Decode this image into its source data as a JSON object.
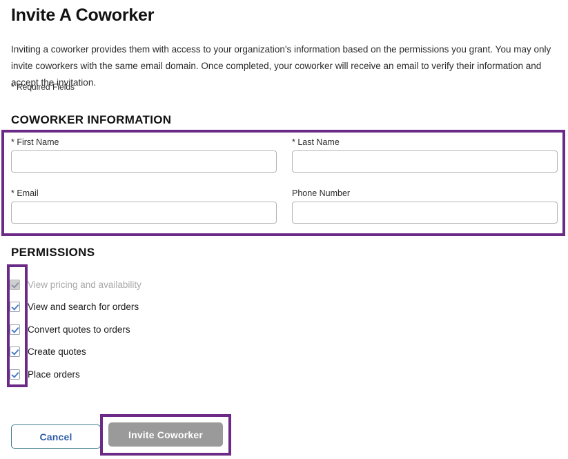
{
  "page": {
    "title": "Invite A Coworker",
    "intro": "Inviting a coworker provides them with access to your organization's information based on the permissions you grant. You may only invite coworkers with the same email domain. Once completed, your coworker will receive an email to verify their information and accept the invitation.",
    "required_note": "* Required Fields"
  },
  "sections": {
    "coworker_information": {
      "header": "COWORKER INFORMATION",
      "fields": [
        {
          "label": "* First Name",
          "value": "",
          "placeholder": ""
        },
        {
          "label": "* Last Name",
          "value": "",
          "placeholder": ""
        },
        {
          "label": "* Email",
          "value": "",
          "placeholder": ""
        },
        {
          "label": "Phone Number",
          "value": "",
          "placeholder": ""
        }
      ]
    },
    "permissions": {
      "header": "PERMISSIONS",
      "items": [
        {
          "label": "View pricing and availability",
          "checked": true,
          "disabled": true
        },
        {
          "label": "View and search for orders",
          "checked": true,
          "disabled": false
        },
        {
          "label": "Convert quotes to orders",
          "checked": true,
          "disabled": false
        },
        {
          "label": "Create quotes",
          "checked": true,
          "disabled": false
        },
        {
          "label": "Place orders",
          "checked": true,
          "disabled": false
        }
      ]
    }
  },
  "actions": {
    "cancel_label": "Cancel",
    "invite_label": "Invite Coworker",
    "invite_disabled": true
  },
  "annotations": {
    "highlight_color": "#6a2a86",
    "boxes": [
      {
        "name": "coworker-information-form"
      },
      {
        "name": "permissions-checkbox-column"
      },
      {
        "name": "invite-coworker-button"
      }
    ]
  },
  "colors": {
    "highlight_purple": "#6a2a86",
    "checkbox_check_blue": "#4b7fc4",
    "cancel_text_blue": "#2f5ca8",
    "cancel_border_teal": "#3a7d8c",
    "disabled_button_gray": "#9a9a9a",
    "disabled_text_gray": "#a9a9a9"
  }
}
